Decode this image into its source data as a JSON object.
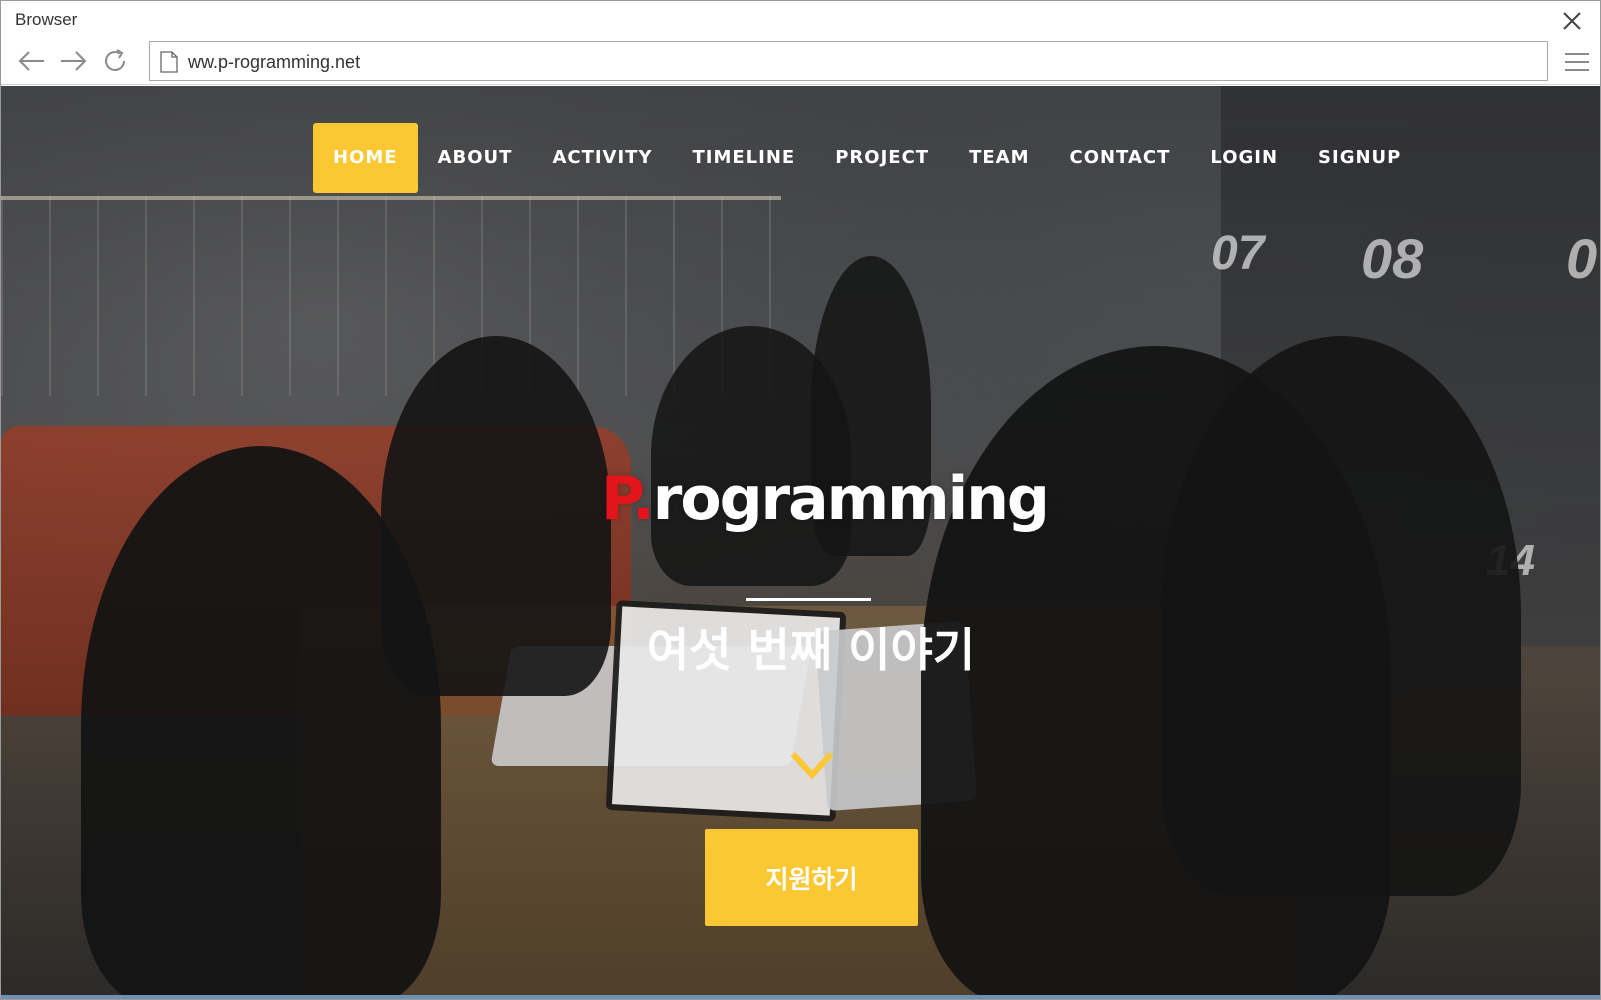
{
  "browser": {
    "window_title": "Browser",
    "url": "ww.p-rogramming.net",
    "icons": {
      "back": "arrow-left-icon",
      "forward": "arrow-right-icon",
      "reload": "reload-icon",
      "page": "page-icon",
      "menu": "hamburger-menu-icon",
      "close": "close-icon"
    }
  },
  "site": {
    "nav": [
      {
        "label": "HOME",
        "active": true
      },
      {
        "label": "ABOUT",
        "active": false
      },
      {
        "label": "ACTIVITY",
        "active": false
      },
      {
        "label": "TIMELINE",
        "active": false
      },
      {
        "label": "PROJECT",
        "active": false
      },
      {
        "label": "TEAM",
        "active": false
      },
      {
        "label": "CONTACT",
        "active": false
      },
      {
        "label": "LOGIN",
        "active": false
      },
      {
        "label": "SIGNUP",
        "active": false
      }
    ],
    "logo": {
      "accent": "P",
      "dot": ".",
      "rest": "rogramming"
    },
    "subtitle": "여섯 번째 이야기",
    "apply_label": "지원하기",
    "scroll_icon": "chevron-down-icon",
    "locker_numbers": [
      "07",
      "08",
      "0",
      "14"
    ]
  },
  "colors": {
    "accent_yellow": "#fbc732",
    "logo_red": "#e3141b",
    "text_white": "#ffffff"
  }
}
